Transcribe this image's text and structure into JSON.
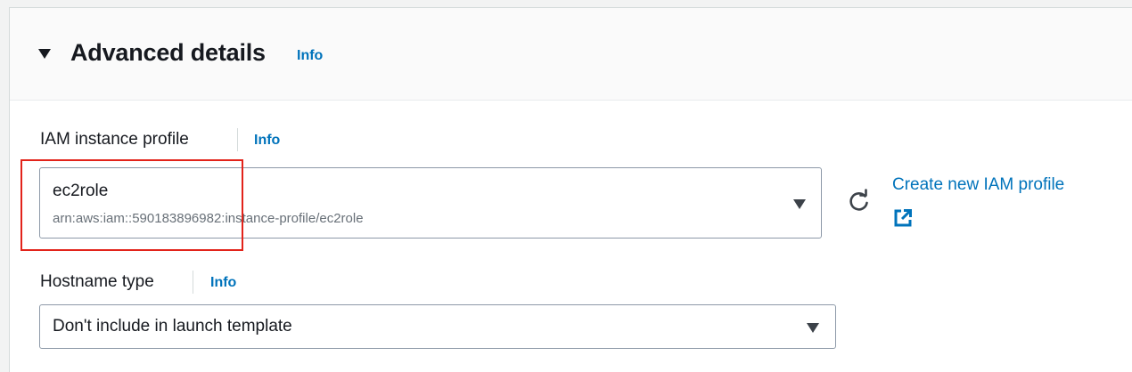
{
  "section": {
    "title": "Advanced details",
    "info_label": "Info"
  },
  "iam_profile": {
    "label": "IAM instance profile",
    "info_label": "Info",
    "selected_name": "ec2role",
    "selected_arn": "arn:aws:iam::590183896982:instance-profile/ec2role",
    "create_link_label": "Create new IAM profile",
    "refresh_icon": "refresh-icon",
    "external_icon": "external-link-icon"
  },
  "hostname_type": {
    "label": "Hostname type",
    "info_label": "Info",
    "selected_value": "Don't include in launch template"
  },
  "colors": {
    "link": "#0073bb",
    "highlight": "#e2231a",
    "border": "#8d99a8"
  }
}
